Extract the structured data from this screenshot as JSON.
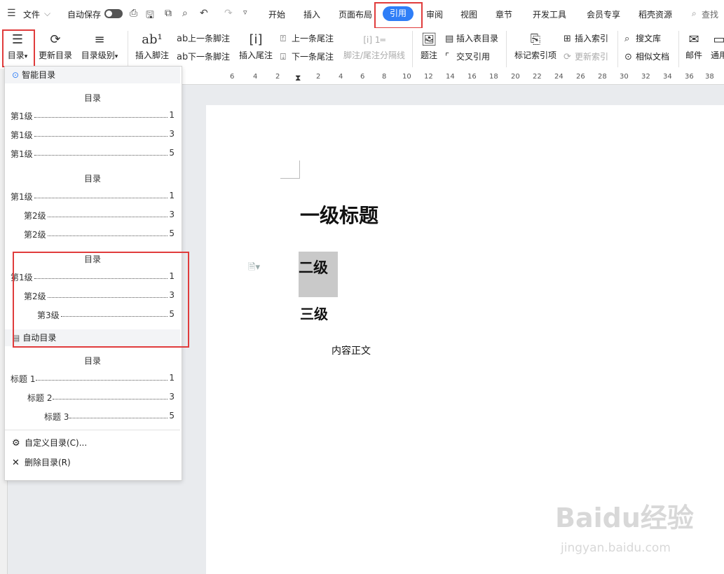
{
  "topbar": {
    "file_label": "文件",
    "autosave_label": "自动保存",
    "tabs": [
      "开始",
      "插入",
      "页面布局",
      "引用",
      "审阅",
      "视图",
      "章节",
      "开发工具",
      "会员专享",
      "稻壳资源"
    ],
    "active_tab": "引用",
    "search_label": "查找"
  },
  "ribbon": {
    "toc": "目录",
    "update_toc": "更新目录",
    "toc_level": "目录级别",
    "insert_footnote": "插入脚注",
    "prev_footnote": "上一条脚注",
    "next_footnote": "下一条脚注",
    "insert_endnote": "插入尾注",
    "prev_endnote": "上一条尾注",
    "next_endnote": "下一条尾注",
    "note_separator": "脚注/尾注分隔线",
    "caption": "题注",
    "insert_table_toc": "插入表目录",
    "cross_ref": "交叉引用",
    "mark_index": "标记索引项",
    "insert_index": "插入索引",
    "update_index": "更新索引",
    "search_lib": "搜文库",
    "similar_docs": "相似文档",
    "mail": "邮件",
    "generic": "通用"
  },
  "ruler": {
    "marks": [
      "6",
      "4",
      "2",
      "2",
      "4",
      "6",
      "8",
      "10",
      "12",
      "14",
      "16",
      "18",
      "20",
      "22",
      "24",
      "26",
      "28",
      "30",
      "32",
      "34",
      "36",
      "38"
    ]
  },
  "dropdown": {
    "smart_header": "智能目录",
    "auto_header": "自动目录",
    "toc_title": "目录",
    "template1": [
      {
        "label": "第1级",
        "page": "1"
      },
      {
        "label": "第1级",
        "page": "3"
      },
      {
        "label": "第1级",
        "page": "5"
      }
    ],
    "template2": [
      {
        "label": "第1级",
        "page": "1"
      },
      {
        "label": "第2级",
        "page": "3"
      },
      {
        "label": "第2级",
        "page": "5"
      }
    ],
    "template3": [
      {
        "label": "第1级",
        "page": "1"
      },
      {
        "label": "第2级",
        "page": "3"
      },
      {
        "label": "第3级",
        "page": "5"
      }
    ],
    "template4": [
      {
        "label": "标题 1",
        "page": "1"
      },
      {
        "label": "标题 2",
        "page": "3"
      },
      {
        "label": "标题 3",
        "page": "5"
      }
    ],
    "custom_toc": "自定义目录(C)...",
    "delete_toc": "删除目录(R)"
  },
  "document": {
    "heading1": "一级标题",
    "heading2": "二级",
    "heading3": "三级",
    "body": "内容正文"
  },
  "watermark": {
    "logo": "Baidu经验",
    "url": "jingyan.baidu.com"
  },
  "colors": {
    "accent": "#2f7ef7",
    "highlight_box": "#e03c3c"
  }
}
